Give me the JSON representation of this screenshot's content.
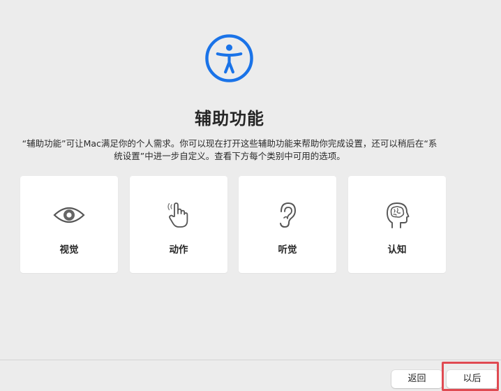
{
  "accent_color": "#1a73e8",
  "hero": {
    "icon": "accessibility-icon"
  },
  "title": "辅助功能",
  "description": {
    "line1": "“辅助功能”可让Mac满足你的个人需求。你可以现在打开这些辅助功能来帮助你完成设置，还可以稍后在“系",
    "line2": "统设置”中进一步自定义。查看下方每个类别中可用的选项。"
  },
  "categories": [
    {
      "label": "视觉",
      "icon": "eye-icon"
    },
    {
      "label": "动作",
      "icon": "hand-pointer-icon"
    },
    {
      "label": "听觉",
      "icon": "ear-icon"
    },
    {
      "label": "认知",
      "icon": "brain-head-icon"
    }
  ],
  "footer": {
    "back_label": "返回",
    "next_label": "以后"
  }
}
